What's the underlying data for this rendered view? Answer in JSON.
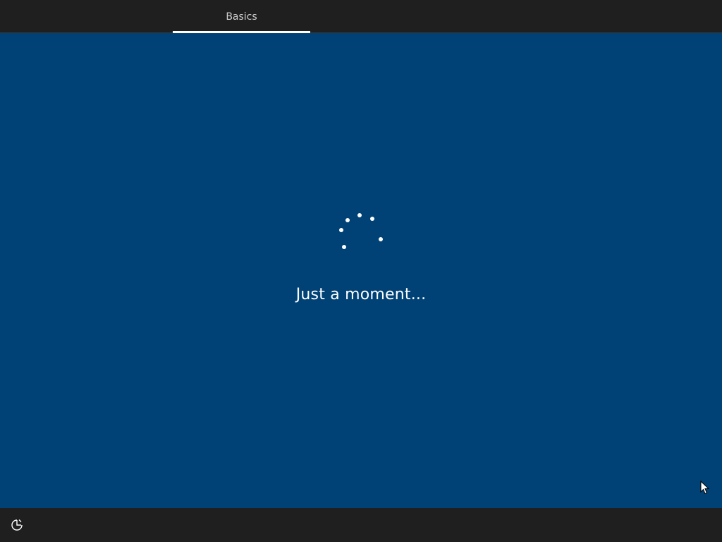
{
  "header": {
    "tabs": [
      {
        "label": "Basics",
        "active": true
      }
    ]
  },
  "main": {
    "status_text": "Just a moment...",
    "spinner_icon": "loading-spinner-icon"
  },
  "footer": {
    "accessibility_icon": "accessibility-icon"
  },
  "colors": {
    "background": "#004275",
    "bars": "#1f1f1f",
    "text": "#ffffff",
    "tab_text": "#d0d0d0"
  }
}
